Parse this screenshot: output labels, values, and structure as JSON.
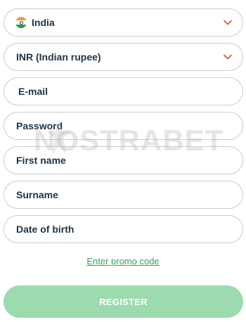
{
  "country": {
    "value": "India",
    "icon": "india-flag-icon"
  },
  "currency": {
    "value": "INR (Indian rupee)"
  },
  "fields": {
    "email": "E-mail",
    "password": "Password",
    "first_name": "First name",
    "surname": "Surname",
    "date_of_birth": "Date of birth"
  },
  "watermark": "NOSTRABET",
  "promo_link": "Enter promo code",
  "register_label": "REGISTER",
  "colors": {
    "chevron": "#e0473a",
    "promo": "#3aa15a",
    "register_bg": "#9bdbae",
    "text": "#1f3446"
  }
}
